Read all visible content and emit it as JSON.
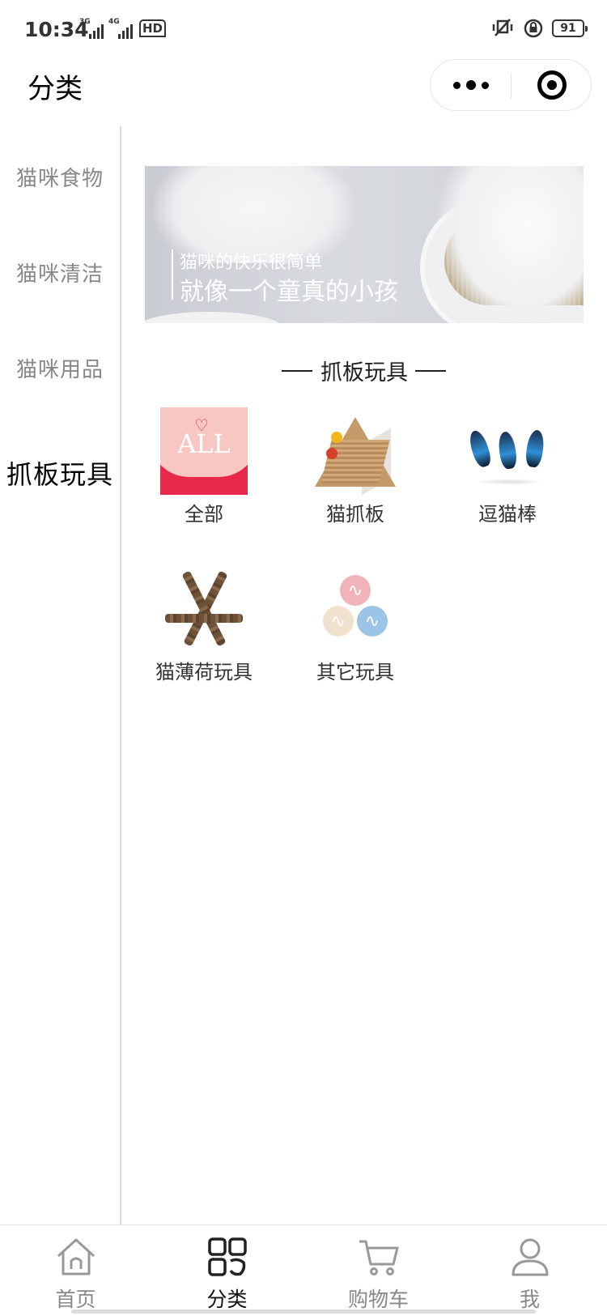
{
  "status_bar": {
    "time": "10:34",
    "network_1": "3G",
    "network_2": "4G",
    "hd_label": "HD",
    "battery": "91",
    "icons": [
      "vibrate-icon",
      "rotation-lock-icon",
      "battery-icon"
    ]
  },
  "nav": {
    "title": "分类",
    "capsule_icons": [
      "more-dots-icon",
      "close-target-icon"
    ]
  },
  "sidebar": {
    "items": [
      {
        "label": "猫咪食物",
        "active": false
      },
      {
        "label": "猫咪清洁",
        "active": false
      },
      {
        "label": "猫咪用品",
        "active": false
      },
      {
        "label": "抓板玩具",
        "active": true
      }
    ]
  },
  "banner": {
    "line1": "猫咪的快乐很简单",
    "line2": "就像一个童真的小孩"
  },
  "section": {
    "title": "抓板玩具"
  },
  "categories": [
    {
      "label": "全部",
      "icon": "all-icon",
      "badge": "ALL"
    },
    {
      "label": "猫抓板",
      "icon": "scratch-board-icon"
    },
    {
      "label": "逗猫棒",
      "icon": "feather-teaser-icon"
    },
    {
      "label": "猫薄荷玩具",
      "icon": "catnip-stick-icon"
    },
    {
      "label": "其它玩具",
      "icon": "toy-balls-icon"
    }
  ],
  "tabbar": {
    "items": [
      {
        "label": "首页",
        "icon": "home-icon",
        "active": false
      },
      {
        "label": "分类",
        "icon": "category-icon",
        "active": true
      },
      {
        "label": "购物车",
        "icon": "cart-icon",
        "active": false
      },
      {
        "label": "我",
        "icon": "user-icon",
        "active": false
      }
    ]
  },
  "colors": {
    "accent_red": "#e8294b",
    "active_text": "#000000",
    "inactive_text": "#888888"
  }
}
